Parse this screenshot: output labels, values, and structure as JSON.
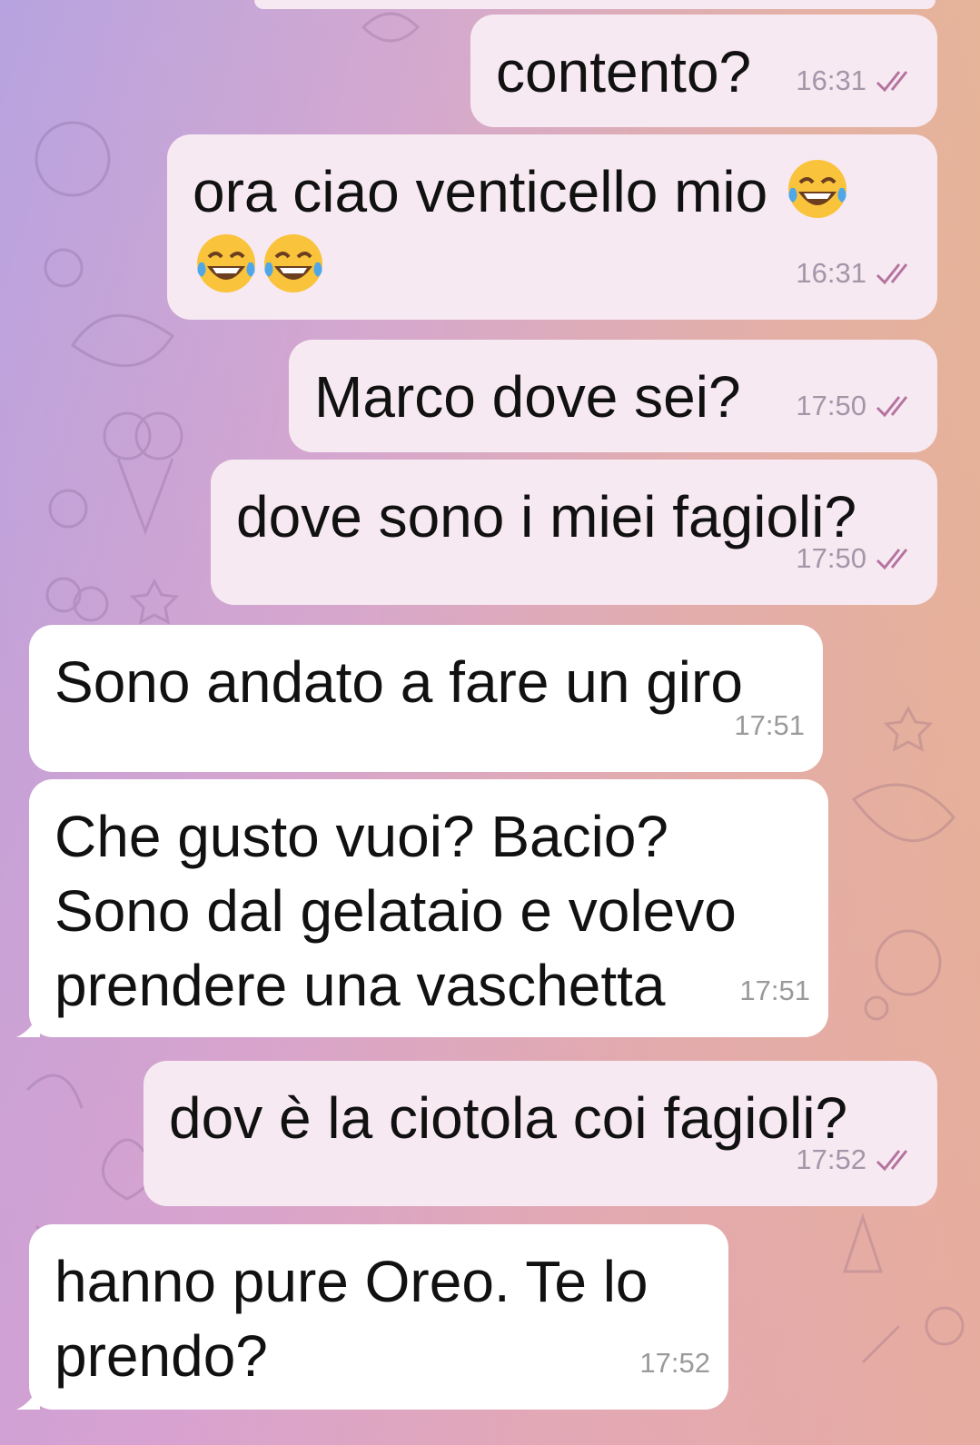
{
  "messages": [
    {
      "direction": "out",
      "text": "contento?",
      "time": "16:31",
      "status": "read"
    },
    {
      "direction": "out",
      "text": "ora ciao venticello mio",
      "emoji_count_line1": 1,
      "emoji_count_line2": 2,
      "emoji": "face-with-tears-of-joy",
      "time": "16:31",
      "status": "read"
    },
    {
      "direction": "out",
      "text": "Marco dove sei?",
      "time": "17:50",
      "status": "read"
    },
    {
      "direction": "out",
      "text": "dove sono i miei fagioli?",
      "time": "17:50",
      "status": "read"
    },
    {
      "direction": "in",
      "text": "Sono andato a fare un giro",
      "time": "17:51"
    },
    {
      "direction": "in",
      "lines": [
        "Che gusto vuoi? Bacio?",
        "Sono dal gelataio e volevo",
        "prendere una vaschetta"
      ],
      "time": "17:51"
    },
    {
      "direction": "out",
      "text": "dov è la ciotola coi fagioli?",
      "time": "17:52",
      "status": "read"
    },
    {
      "direction": "in",
      "lines": [
        "hanno pure Oreo. Te lo",
        "prendo?"
      ],
      "time": "17:52"
    }
  ],
  "colors": {
    "outgoing_bubble": "#f7e9f1",
    "incoming_bubble": "#ffffff",
    "read_ticks": "#b4739e",
    "time_text": "#9a9a9a"
  }
}
